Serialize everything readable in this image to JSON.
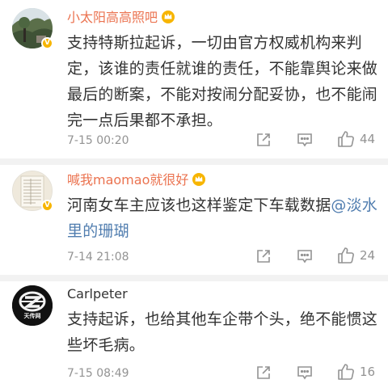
{
  "comments": [
    {
      "username": "小太阳高高照吧",
      "content": "支持特斯拉起诉，一切由官方权威机构来判定，该谁的责任就谁的责任，不能靠舆论来做最后的断案，不能对按闹分配妥协，也不能闹完一点后果都不承担。",
      "time": "7-15 00:20",
      "likes": "44",
      "avatar_icon": "landscape-avatar-icon",
      "badge_icon": "verified-badge-icon",
      "crown_icon": "crown-icon"
    },
    {
      "username": "喊我maomao就很好",
      "content_text": "河南女车主应该也这样鉴定下车载数据",
      "mention": "@淡水里的珊瑚",
      "time": "7-14 21:08",
      "likes": "24",
      "avatar_icon": "document-avatar-icon",
      "badge_icon": "verified-badge-icon",
      "crown_icon": "crown-icon"
    },
    {
      "username": "Carlpeter",
      "content": "支持起诉，也给其他车企带个头，绝不能惯这些坏毛病。",
      "time": "7-15 08:49",
      "likes": "16",
      "avatar_icon": "logo-avatar-icon",
      "avatar_logo_text": "天传网"
    }
  ],
  "colors": {
    "username_vip": "#eb7350",
    "username_normal": "#333333",
    "mention": "#507daf",
    "meta": "#939393",
    "badge": "#f7b500",
    "divider": "#f2f2f2"
  },
  "actions": [
    "share-icon",
    "comment-icon",
    "like-icon"
  ]
}
